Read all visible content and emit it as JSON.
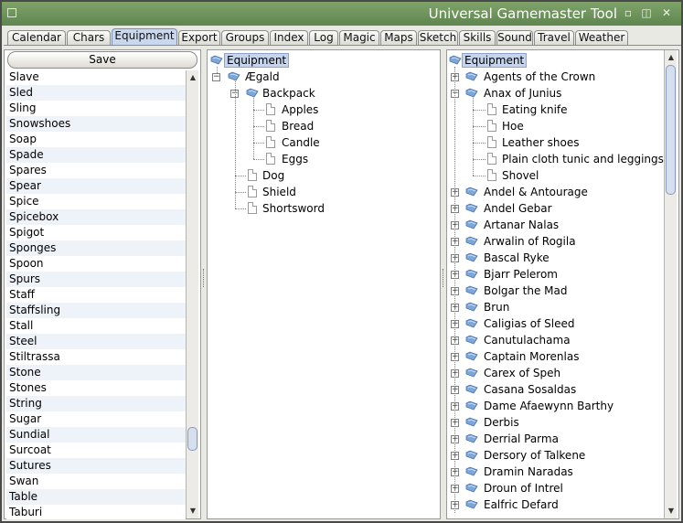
{
  "window": {
    "title": "Universal Gamemaster Tool",
    "controls": [
      "shade-icon",
      "maximize-icon",
      "close-icon"
    ]
  },
  "tabs": [
    "Calendar",
    "Chars",
    "Equipment",
    "Export",
    "Groups",
    "Index",
    "Log",
    "Magic",
    "Maps",
    "Sketch",
    "Skills",
    "Sound",
    "Travel",
    "Weather"
  ],
  "active_tab": "Equipment",
  "left_panel": {
    "save_label": "Save",
    "items": [
      "Slave",
      "Sled",
      "Sling",
      "Snowshoes",
      "Soap",
      "Spade",
      "Spares",
      "Spear",
      "Spice",
      "Spicebox",
      "Spigot",
      "Sponges",
      "Spoon",
      "Spurs",
      "Staff",
      "Staffsling",
      "Stall",
      "Steel",
      "Stiltrassa",
      "Stone",
      "Stones",
      "String",
      "Sugar",
      "Sundial",
      "Surcoat",
      "Sutures",
      "Swan",
      "Table",
      "Taburi"
    ]
  },
  "middle_tree": {
    "root": "Equipment",
    "child": "Ægald",
    "backpack": "Backpack",
    "backpack_items": [
      "Apples",
      "Bread",
      "Candle",
      "Eggs"
    ],
    "other_items": [
      "Dog",
      "Shield",
      "Shortsword"
    ]
  },
  "right_tree": {
    "root": "Equipment",
    "first": "Agents of the Crown",
    "expanded": "Anax of Junius",
    "expanded_items": [
      "Eating knife",
      "Hoe",
      "Leather shoes",
      "Plain cloth tunic and leggings",
      "Shovel"
    ],
    "groups": [
      "Andel & Antourage",
      "Andel Gebar",
      "Artanar Nalas",
      "Arwalin of Rogila",
      "Bascal Ryke",
      "Bjarr Pelerom",
      "Bolgar the Mad",
      "Brun",
      "Caligias of Sleed",
      "Canutulachama",
      "Captain Morenlas",
      "Carex of Speh",
      "Casana Sosaldas",
      "Dame Afaewynn Barthy",
      "Derbis",
      "Derrial Parma",
      "Dersory of Talkene",
      "Dramin Naradas",
      "Droun of Intrel",
      "Ealfric Defard"
    ]
  }
}
